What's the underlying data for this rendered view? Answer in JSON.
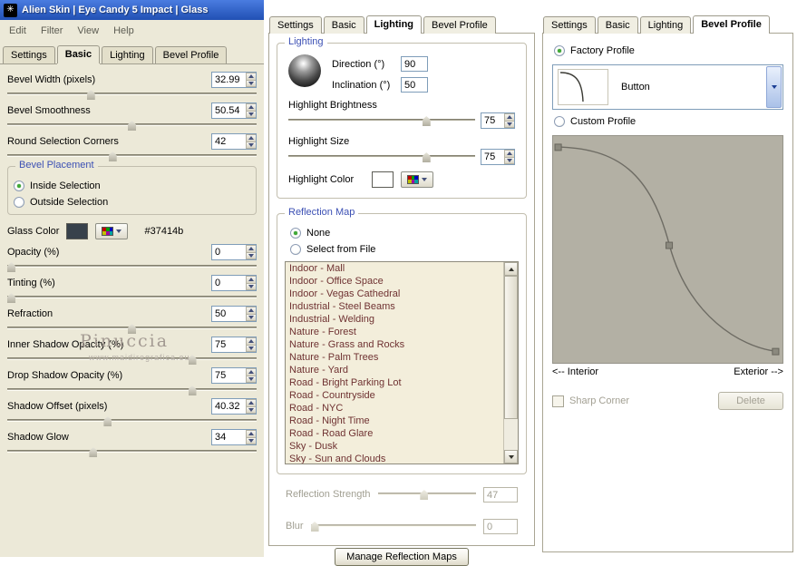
{
  "window": {
    "title": "Alien Skin | Eye Candy 5 Impact | Glass",
    "menu": [
      "Edit",
      "Filter",
      "View",
      "Help"
    ]
  },
  "tab_labels": [
    "Settings",
    "Basic",
    "Lighting",
    "Bevel Profile"
  ],
  "colors": {
    "titlebar_top": "#4a7ce0",
    "titlebar_bottom": "#2150b4",
    "group_title": "#3c50b4",
    "list_text": "#6f3232",
    "list_bg": "#f3eedb",
    "radio_dot": "#3faa36"
  },
  "left": {
    "active_tab": "Basic",
    "sliders_top": [
      {
        "label": "Bevel Width (pixels)",
        "value": "32.99",
        "pct": 33
      },
      {
        "label": "Bevel Smoothness",
        "value": "50.54",
        "pct": 50
      },
      {
        "label": "Round Selection Corners",
        "value": "42",
        "pct": 42
      }
    ],
    "bevel_placement": {
      "title": "Bevel Placement",
      "options": [
        {
          "label": "Inside Selection",
          "selected": true
        },
        {
          "label": "Outside Selection",
          "selected": false
        }
      ]
    },
    "glass_color": {
      "label": "Glass Color",
      "hex": "#37414b",
      "swatch": "#37414b"
    },
    "watermark": {
      "line1": "Pinuccia",
      "line2": "www.maidiregrafica.eu"
    },
    "sliders_bottom": [
      {
        "label": "Opacity (%)",
        "value": "0",
        "pct": 0
      },
      {
        "label": "Tinting (%)",
        "value": "0",
        "pct": 0
      },
      {
        "label": "Refraction",
        "value": "50",
        "pct": 50
      },
      {
        "label": "Inner Shadow Opacity (%)",
        "value": "75",
        "pct": 75
      },
      {
        "label": "Drop Shadow Opacity (%)",
        "value": "75",
        "pct": 75
      },
      {
        "label": "Shadow Offset (pixels)",
        "value": "40.32",
        "pct": 40
      },
      {
        "label": "Shadow Glow",
        "value": "34",
        "pct": 34
      }
    ]
  },
  "middle": {
    "active_tab": "Lighting",
    "lighting": {
      "title": "Lighting",
      "direction": {
        "label": "Direction (°)",
        "value": "90"
      },
      "inclination": {
        "label": "Inclination (°)",
        "value": "50"
      },
      "sliders": [
        {
          "label": "Highlight Brightness",
          "value": "75",
          "pct": 75
        },
        {
          "label": "Highlight Size",
          "value": "75",
          "pct": 75
        }
      ],
      "highlight_color_label": "Highlight Color",
      "highlight_color": "#ffffff"
    },
    "reflection": {
      "title": "Reflection Map",
      "options": [
        {
          "label": "None",
          "selected": true
        },
        {
          "label": "Select from File",
          "selected": false
        }
      ],
      "list": [
        "Indoor - Mall",
        "Indoor - Office Space",
        "Indoor - Vegas Cathedral",
        "Industrial - Steel Beams",
        "Industrial - Welding",
        "Nature - Forest",
        "Nature - Grass and Rocks",
        "Nature - Palm Trees",
        "Nature - Yard",
        "Road - Bright Parking Lot",
        "Road - Countryside",
        "Road - NYC",
        "Road - Night Time",
        "Road - Road Glare",
        "Sky - Dusk",
        "Sky - Sun and Clouds"
      ]
    },
    "disabled_sliders": [
      {
        "label": "Reflection Strength",
        "value": "47",
        "pct": 47
      },
      {
        "label": "Blur",
        "value": "0",
        "pct": 0
      }
    ],
    "manage_button": "Manage Reflection Maps"
  },
  "right": {
    "active_tab": "Bevel Profile",
    "factory_label": "Factory Profile",
    "factory_selected": true,
    "profile_name": "Button",
    "custom_label": "Custom Profile",
    "custom_selected": false,
    "interior_label": "<-- Interior",
    "exterior_label": "Exterior -->",
    "sharp_corner_label": "Sharp Corner",
    "delete_label": "Delete"
  }
}
